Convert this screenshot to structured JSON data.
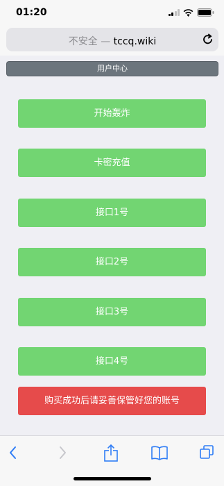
{
  "status_bar": {
    "time": "01:20"
  },
  "browser": {
    "url_insecure_label": "不安全 — ",
    "url_domain": "tccq.wiki"
  },
  "topnav": {
    "label": "用户中心"
  },
  "buttons": [
    {
      "label": "开始轰炸"
    },
    {
      "label": "卡密充值"
    },
    {
      "label": "接口1号"
    },
    {
      "label": "接口2号"
    },
    {
      "label": "接口3号"
    },
    {
      "label": "接口4号"
    }
  ],
  "notice": {
    "label": "购买成功后请妥善保管好您的账号"
  },
  "colors": {
    "accent_green": "#72d572",
    "alert_red": "#e64b4b",
    "nav_gray": "#6c757d",
    "ios_blue": "#2f7df6"
  }
}
